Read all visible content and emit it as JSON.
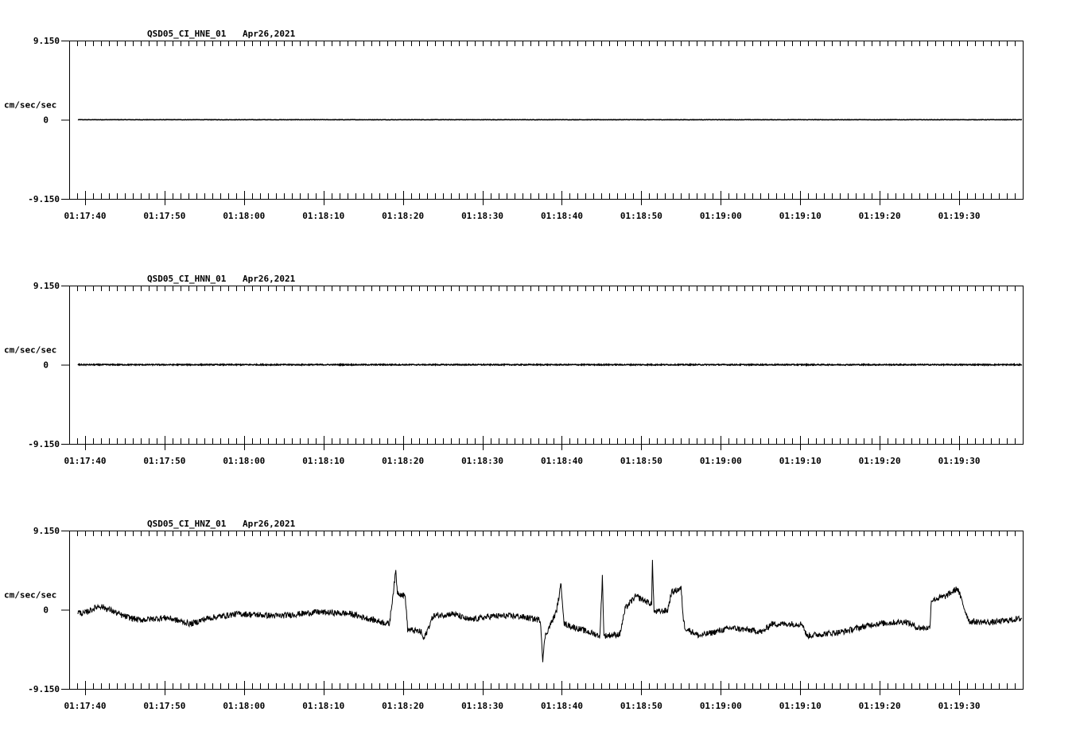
{
  "chart_data": [
    {
      "type": "line",
      "title": "QSD05_CI_HNE_01",
      "date": "Apr26,2021",
      "ylabel": "cm/sec/sec",
      "ylim": [
        -9.15,
        9.15
      ],
      "ytick_labels": [
        "9.150",
        "0",
        "-9.150"
      ],
      "x_start": "01:17:38",
      "xlim_seconds": [
        0,
        120
      ],
      "xtick_labels": [
        "01:17:40",
        "01:17:50",
        "01:18:00",
        "01:18:10",
        "01:18:20",
        "01:18:30",
        "01:18:40",
        "01:18:50",
        "01:19:00",
        "01:19:10",
        "01:19:20",
        "01:19:30"
      ],
      "noise": 0.02,
      "series": [
        [
          1.1,
          0
        ],
        [
          119.9,
          0
        ]
      ]
    },
    {
      "type": "line",
      "title": "QSD05_CI_HNN_01",
      "date": "Apr26,2021",
      "ylabel": "cm/sec/sec",
      "ylim": [
        -9.15,
        9.15
      ],
      "ytick_labels": [
        "9.150",
        "0",
        "-9.150"
      ],
      "x_start": "01:17:38",
      "xlim_seconds": [
        0,
        120
      ],
      "xtick_labels": [
        "01:17:40",
        "01:17:50",
        "01:18:00",
        "01:18:10",
        "01:18:20",
        "01:18:30",
        "01:18:40",
        "01:18:50",
        "01:19:00",
        "01:19:10",
        "01:19:20",
        "01:19:30"
      ],
      "noise": 0.06,
      "series": [
        [
          1.1,
          0
        ],
        [
          119.9,
          0
        ]
      ]
    },
    {
      "type": "line",
      "title": "QSD05_CI_HNZ_01",
      "date": "Apr26,2021",
      "ylabel": "cm/sec/sec",
      "ylim": [
        -9.15,
        9.15
      ],
      "ytick_labels": [
        "9.150",
        "0",
        "-9.150"
      ],
      "x_start": "01:17:38",
      "xlim_seconds": [
        0,
        120
      ],
      "xtick_labels": [
        "01:17:40",
        "01:17:50",
        "01:18:00",
        "01:18:10",
        "01:18:20",
        "01:18:30",
        "01:18:40",
        "01:18:50",
        "01:19:00",
        "01:19:10",
        "01:19:20",
        "01:19:30"
      ],
      "noise": 0.35,
      "series": [
        [
          1.1,
          -0.27
        ],
        [
          1.8,
          -0.46
        ],
        [
          3.8,
          0.46
        ],
        [
          5.3,
          -0.09
        ],
        [
          6.8,
          -0.73
        ],
        [
          8.8,
          -1.19
        ],
        [
          12.3,
          -0.92
        ],
        [
          15.3,
          -1.65
        ],
        [
          17.3,
          -1.01
        ],
        [
          21.3,
          -0.46
        ],
        [
          26.3,
          -0.73
        ],
        [
          31.3,
          -0.27
        ],
        [
          35.3,
          -0.46
        ],
        [
          38.3,
          -1.19
        ],
        [
          40.3,
          -1.65
        ],
        [
          41.1,
          4.48
        ],
        [
          41.3,
          2.01
        ],
        [
          42.3,
          1.56
        ],
        [
          42.6,
          -2.29
        ],
        [
          44.3,
          -2.56
        ],
        [
          44.6,
          -3.48
        ],
        [
          45.8,
          -0.73
        ],
        [
          48.3,
          -0.46
        ],
        [
          50.3,
          -1.19
        ],
        [
          53.3,
          -0.73
        ],
        [
          56.3,
          -0.73
        ],
        [
          59.3,
          -1.19
        ],
        [
          59.6,
          -5.76
        ],
        [
          59.9,
          -3.02
        ],
        [
          61.3,
          -0.27
        ],
        [
          61.9,
          2.93
        ],
        [
          62.3,
          -1.65
        ],
        [
          65.3,
          -2.56
        ],
        [
          66.8,
          -3.02
        ],
        [
          67.1,
          3.84
        ],
        [
          67.3,
          -3.02
        ],
        [
          69.3,
          -2.84
        ],
        [
          70.0,
          0.18
        ],
        [
          71.3,
          1.56
        ],
        [
          73.3,
          0.64
        ],
        [
          73.4,
          5.67
        ],
        [
          73.6,
          -0.27
        ],
        [
          75.3,
          -0.09
        ],
        [
          75.8,
          2.01
        ],
        [
          77.0,
          2.47
        ],
        [
          77.3,
          -1.19
        ],
        [
          77.5,
          -2.1
        ],
        [
          79.3,
          -3.02
        ],
        [
          81.3,
          -2.56
        ],
        [
          83.3,
          -2.1
        ],
        [
          87.3,
          -2.56
        ],
        [
          88.3,
          -1.65
        ],
        [
          92.3,
          -1.65
        ],
        [
          92.8,
          -3.02
        ],
        [
          97.3,
          -2.56
        ],
        [
          101.3,
          -1.65
        ],
        [
          105.3,
          -1.37
        ],
        [
          106.8,
          -2.1
        ],
        [
          108.3,
          -2.1
        ],
        [
          108.5,
          1.1
        ],
        [
          110.3,
          1.56
        ],
        [
          111.8,
          2.47
        ],
        [
          112.8,
          -0.27
        ],
        [
          113.3,
          -1.37
        ],
        [
          116.3,
          -1.46
        ],
        [
          119.9,
          -1.01
        ]
      ]
    }
  ]
}
